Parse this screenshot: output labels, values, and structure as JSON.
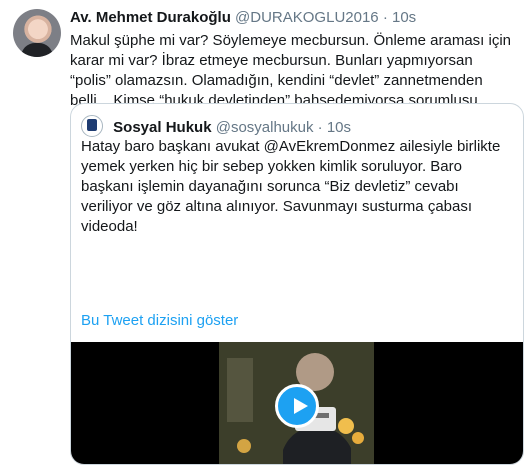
{
  "tweet": {
    "author_name": "Av. Mehmet Durakoğlu",
    "handle": "@DURAKOGLU2016",
    "separator": "·",
    "time": "10s",
    "text": "Makul şüphe mi var? Söylemeye mecbursun. Önleme araması için karar mi var? İbraz etmeye mecbursun. Bunları yapmıyorsan “polis” olamazsın. Olamadığın, kendini “devlet” zannetmenden belli... Kimse “hukuk devletinden” bahsedemiyorsa sorumlusu bunlardır."
  },
  "quote": {
    "author_name": "Sosyal Hukuk",
    "handle": "@sosyalhukuk",
    "separator": "·",
    "time": "10s",
    "text": "Hatay baro başkanı avukat @AvEkremDonmez ailesiyle birlikte yemek yerken hiç bir sebep yokken kimlik soruluyor. Baro başkanı işlemin dayanağını sorunca “Biz devletiz” cevabı veriliyor ve göz altına alınıyor. Savunmayı susturma çabası videoda!",
    "thread_link": "Bu Tweet dizisini göster"
  },
  "icons": {
    "play": "play-icon"
  },
  "colors": {
    "link": "#1da1f2",
    "secondary_text": "#657786",
    "border": "#ccd6dd"
  }
}
